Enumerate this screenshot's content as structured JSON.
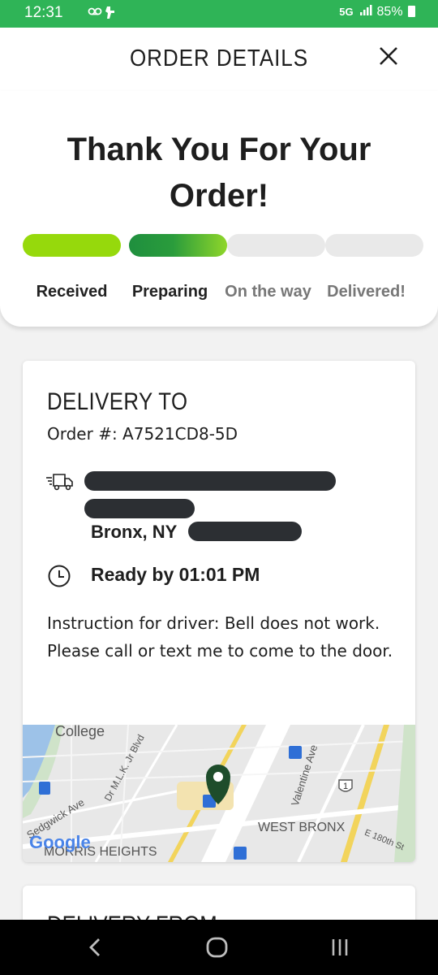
{
  "status_bar": {
    "time": "12:31",
    "network": "5G",
    "battery": "85%"
  },
  "header": {
    "title": "ORDER DETAILS"
  },
  "hero": {
    "thank_you": "Thank You For Your Order!",
    "steps": [
      {
        "label": "Received",
        "state": "done"
      },
      {
        "label": "Preparing",
        "state": "active"
      },
      {
        "label": "On the way",
        "state": "pending"
      },
      {
        "label": "Delivered!",
        "state": "pending"
      }
    ]
  },
  "delivery": {
    "title": "DELIVERY TO",
    "order_number": "Order #: A7521CD8-5D",
    "city": "Bronx, NY",
    "ready_by": "Ready by 01:01 PM",
    "instruction": "Instruction for driver: Bell does not work. Please call or text me to come to the door.",
    "map": {
      "labels": {
        "college": "College",
        "sedgwick": "Sedgwick Ave",
        "mlk": "Dr M.L.K. Jr Blvd",
        "valentine": "Valentine Ave",
        "west_bronx": "WEST BRONX",
        "e180": "E 180th St",
        "morris": "MORRIS HEIGHTS",
        "route": "1",
        "google": "Google"
      }
    }
  },
  "delivery_from": {
    "title": "DELIVERY FROM"
  },
  "colors": {
    "status_bar": "#2fb457",
    "received": "#96d90c",
    "preparing_start": "#1f8f3e",
    "preparing_end": "#8fd62a",
    "pending": "#e9e9e9",
    "pin": "#1e4d2b"
  }
}
